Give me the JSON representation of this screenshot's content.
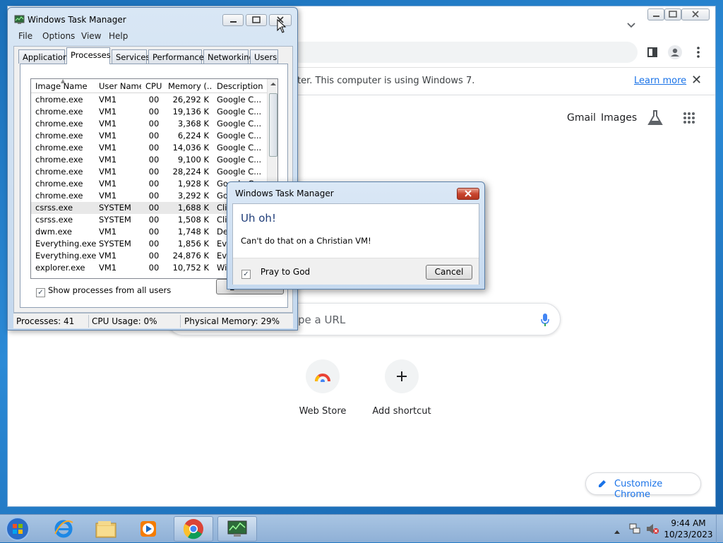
{
  "chrome": {
    "infobar_message": "ter. This computer is using Windows 7.",
    "learn_more": "Learn more",
    "close_glyph": "✕",
    "links": {
      "gmail": "Gmail",
      "images": "Images"
    },
    "search_placeholder": "pe a URL",
    "shortcuts": [
      {
        "label": "Web Store",
        "icon": "web-store-icon"
      },
      {
        "label": "Add shortcut",
        "icon": "plus-icon"
      }
    ],
    "customize_label": "Customize Chrome"
  },
  "task_manager": {
    "title": "Windows Task Manager",
    "menu": [
      "File",
      "Options",
      "View",
      "Help"
    ],
    "tabs": [
      "Applications",
      "Processes",
      "Services",
      "Performance",
      "Networking",
      "Users"
    ],
    "active_tab": "Processes",
    "columns": [
      "Image Name",
      "User Name",
      "CPU",
      "Memory (...",
      "Description"
    ],
    "rows": [
      [
        "chrome.exe",
        "VM1",
        "00",
        "26,292 K",
        "Google C..."
      ],
      [
        "chrome.exe",
        "VM1",
        "00",
        "19,136 K",
        "Google C..."
      ],
      [
        "chrome.exe",
        "VM1",
        "00",
        "3,368 K",
        "Google C..."
      ],
      [
        "chrome.exe",
        "VM1",
        "00",
        "6,224 K",
        "Google C..."
      ],
      [
        "chrome.exe",
        "VM1",
        "00",
        "14,036 K",
        "Google C..."
      ],
      [
        "chrome.exe",
        "VM1",
        "00",
        "9,100 K",
        "Google C..."
      ],
      [
        "chrome.exe",
        "VM1",
        "00",
        "28,224 K",
        "Google C..."
      ],
      [
        "chrome.exe",
        "VM1",
        "00",
        "1,928 K",
        "Google C..."
      ],
      [
        "chrome.exe",
        "VM1",
        "00",
        "3,292 K",
        "Goo"
      ],
      [
        "csrss.exe",
        "SYSTEM",
        "00",
        "1,688 K",
        "Clie"
      ],
      [
        "csrss.exe",
        "SYSTEM",
        "00",
        "1,508 K",
        "Clie"
      ],
      [
        "dwm.exe",
        "VM1",
        "00",
        "1,748 K",
        "Des"
      ],
      [
        "Everything.exe",
        "SYSTEM",
        "00",
        "1,856 K",
        "Eve"
      ],
      [
        "Everything.exe",
        "VM1",
        "00",
        "24,876 K",
        "Eve"
      ],
      [
        "explorer.exe",
        "VM1",
        "00",
        "10,752 K",
        "Win"
      ]
    ],
    "show_all_label": "Show processes from all users",
    "end_button": "E",
    "status": {
      "processes": "Processes: 41",
      "cpu": "CPU Usage: 0%",
      "memory": "Physical Memory: 29%"
    }
  },
  "dialog": {
    "title": "Windows Task Manager",
    "heading": "Uh oh!",
    "message": "Can't do that on a Christian VM!",
    "checkbox_label": "Pray to God",
    "checkbox_checked": true,
    "cancel": "Cancel"
  },
  "taskbar": {
    "time": "9:44 AM",
    "date": "10/23/2023",
    "items": [
      "start-orb-icon",
      "internet-explorer-icon",
      "file-explorer-icon",
      "media-player-icon",
      "chrome-icon",
      "task-manager-icon"
    ]
  }
}
